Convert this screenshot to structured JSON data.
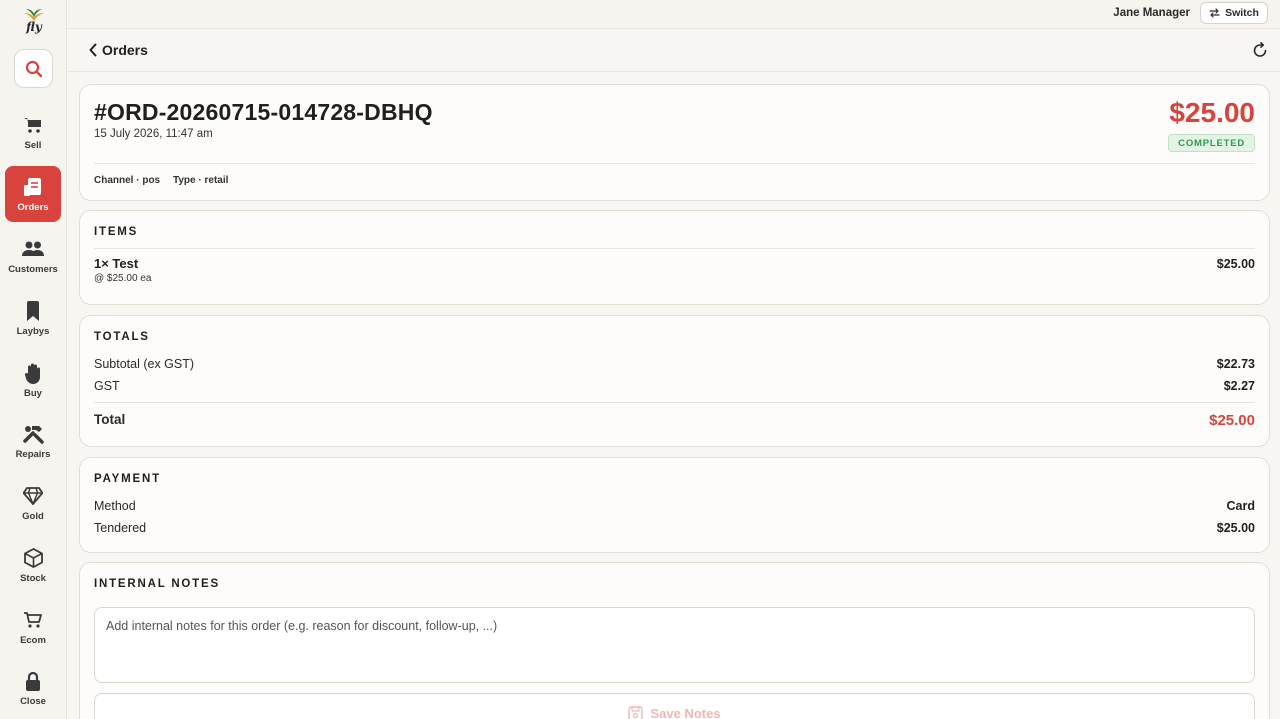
{
  "app": {
    "logo_text": "fly"
  },
  "sidebar": {
    "items": [
      {
        "label": "Sell",
        "icon": "cart-icon"
      },
      {
        "label": "Orders",
        "icon": "orders-icon",
        "active": true
      },
      {
        "label": "Customers",
        "icon": "users-icon"
      },
      {
        "label": "Laybys",
        "icon": "bookmark-icon"
      },
      {
        "label": "Buy",
        "icon": "hand-icon"
      },
      {
        "label": "Repairs",
        "icon": "tools-icon"
      },
      {
        "label": "Gold",
        "icon": "diamond-icon"
      },
      {
        "label": "Stock",
        "icon": "box-icon"
      },
      {
        "label": "Ecom",
        "icon": "ecom-cart-icon"
      },
      {
        "label": "Close",
        "icon": "lock-icon"
      }
    ]
  },
  "topbar": {
    "user_name": "Jane Manager",
    "switch_label": "Switch"
  },
  "header": {
    "back_label": "Orders"
  },
  "order": {
    "id": "#ORD-20260715-014728-DBHQ",
    "date": "15 July 2026, 11:47 am",
    "total": "$25.00",
    "status": "COMPLETED",
    "channel_label": "Channel",
    "channel_value": "pos",
    "type_label": "Type",
    "type_value": "retail"
  },
  "items_section": {
    "title": "ITEMS",
    "items": [
      {
        "name": "1× Test",
        "unit_price": "@ $25.00 ea",
        "amount": "$25.00"
      }
    ]
  },
  "totals_section": {
    "title": "TOTALS",
    "subtotal_label": "Subtotal (ex GST)",
    "subtotal_value": "$22.73",
    "gst_label": "GST",
    "gst_value": "$2.27",
    "total_label": "Total",
    "total_value": "$25.00"
  },
  "payment_section": {
    "title": "PAYMENT",
    "method_label": "Method",
    "method_value": "Card",
    "tendered_label": "Tendered",
    "tendered_value": "$25.00"
  },
  "notes_section": {
    "title": "INTERNAL NOTES",
    "placeholder": "Add internal notes for this order (e.g. reason for discount, follow-up, ...)",
    "value": "",
    "save_label": "Save Notes"
  },
  "colors": {
    "accent": "#d8443d",
    "status_green": "#2e9a4b"
  }
}
